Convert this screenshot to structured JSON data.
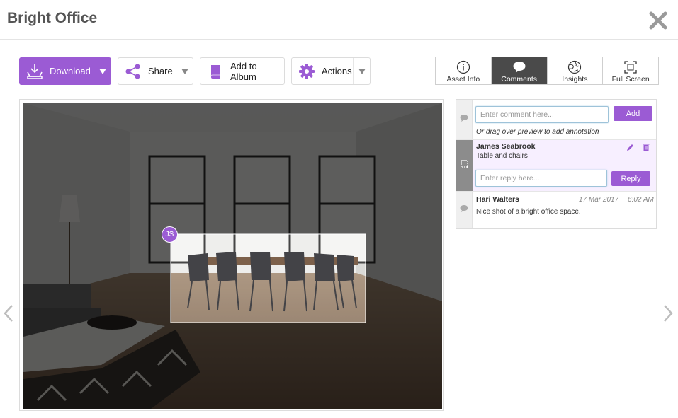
{
  "header": {
    "title": "Bright Office",
    "close_icon": "close-x-icon"
  },
  "toolbar": {
    "download_label": "Download",
    "share_label": "Share",
    "add_to_album_label": "Add to Album",
    "actions_label": "Actions"
  },
  "tabs": [
    {
      "label": "Asset Info",
      "icon": "info-icon",
      "active": false
    },
    {
      "label": "Comments",
      "icon": "speech-bubble-icon",
      "active": true
    },
    {
      "label": "Insights",
      "icon": "globe-icon",
      "active": false
    },
    {
      "label": "Full Screen",
      "icon": "fullscreen-icon",
      "active": false
    }
  ],
  "preview": {
    "annotation_initials": "JS"
  },
  "comments": {
    "input_placeholder": "Enter comment here...",
    "add_label": "Add",
    "hint": "Or drag over preview to add annotation",
    "items": [
      {
        "author": "James Seabrook",
        "text": "Table and chairs",
        "reply_placeholder": "Enter reply here...",
        "reply_label": "Reply"
      },
      {
        "author": "Hari Walters",
        "date": "17 Mar 2017",
        "time": "6:02 AM",
        "text": "Nice shot of a bright office space."
      }
    ]
  },
  "colors": {
    "accent": "#9b5bd4",
    "active_tab": "#4a4a4a"
  }
}
